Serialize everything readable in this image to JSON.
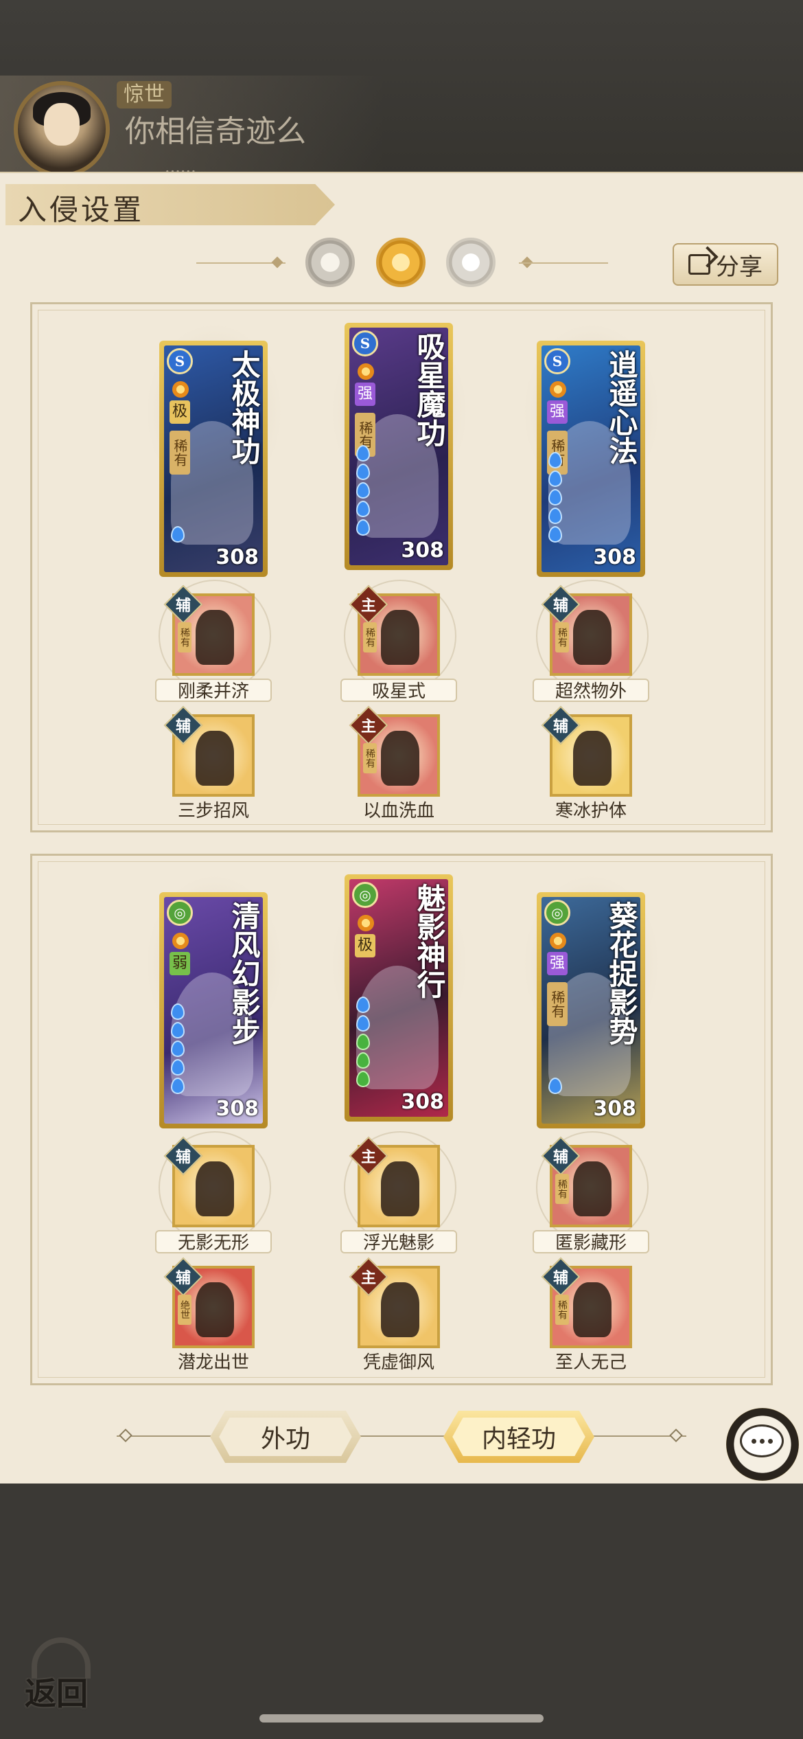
{
  "player": {
    "title_badge": "惊世",
    "name": "你相信奇迹么",
    "sub": "······"
  },
  "header": {
    "title": "入侵设置"
  },
  "share_button": {
    "label": "分享"
  },
  "sections": [
    {
      "cards": [
        {
          "name": "太极神功",
          "type_icon": "S",
          "grade": "极",
          "grade_color": "gold",
          "rarity": "稀有",
          "drops": [
            "blue"
          ],
          "level": "308"
        },
        {
          "name": "吸星魔功",
          "type_icon": "S",
          "grade": "强",
          "grade_color": "purple",
          "rarity": "稀有",
          "drops": [
            "blue",
            "blue",
            "blue",
            "blue",
            "blue"
          ],
          "level": "308"
        },
        {
          "name": "逍遥心法",
          "type_icon": "S",
          "grade": "强",
          "grade_color": "purple",
          "rarity": "稀有",
          "drops": [
            "blue",
            "blue",
            "blue",
            "blue",
            "blue"
          ],
          "level": "308"
        }
      ],
      "skills_row1": [
        {
          "role": "辅",
          "rare": "稀有",
          "label": "刚柔并济",
          "bg": "#e38b7a"
        },
        {
          "role": "主",
          "rare": "稀有",
          "label": "吸星式",
          "bg": "#d9776a"
        },
        {
          "role": "辅",
          "rare": "稀有",
          "label": "超然物外",
          "bg": "#d8786f"
        }
      ],
      "skills_row2": [
        {
          "role": "辅",
          "rare": "",
          "label": "三步招风",
          "bg": "#f0c468"
        },
        {
          "role": "主",
          "rare": "稀有",
          "label": "以血洗血",
          "bg": "#e07d6f"
        },
        {
          "role": "辅",
          "rare": "",
          "label": "寒冰护体",
          "bg": "#f2cf6d"
        }
      ]
    },
    {
      "cards": [
        {
          "name": "清风幻影步",
          "type_icon": "◎",
          "grade": "弱",
          "grade_color": "green",
          "rarity": "",
          "drops": [
            "blue",
            "blue",
            "blue",
            "blue",
            "blue"
          ],
          "level": "308"
        },
        {
          "name": "魅影神行",
          "type_icon": "◎",
          "grade": "极",
          "grade_color": "gold",
          "rarity": "",
          "drops": [
            "blue",
            "blue",
            "green",
            "green",
            "green"
          ],
          "level": "308"
        },
        {
          "name": "葵花捉影势",
          "type_icon": "◎",
          "grade": "强",
          "grade_color": "purple",
          "rarity": "稀有",
          "drops": [
            "blue"
          ],
          "level": "308"
        }
      ],
      "skills_row1": [
        {
          "role": "辅",
          "rare": "",
          "label": "无影无形",
          "bg": "#f0c468"
        },
        {
          "role": "主",
          "rare": "",
          "label": "浮光魅影",
          "bg": "#f0c468"
        },
        {
          "role": "辅",
          "rare": "稀有",
          "label": "匿影藏形",
          "bg": "#d9776a"
        }
      ],
      "skills_row2": [
        {
          "role": "辅",
          "rare": "绝世",
          "label": "潜龙出世",
          "bg": "#d9574a"
        },
        {
          "role": "主",
          "rare": "",
          "label": "凭虚御风",
          "bg": "#f0c468"
        },
        {
          "role": "辅",
          "rare": "稀有",
          "label": "至人无己",
          "bg": "#e2796a"
        }
      ]
    }
  ],
  "tabs": [
    {
      "label": "外功"
    },
    {
      "label": "内轻功"
    }
  ],
  "back_button": {
    "label": "返回"
  },
  "colors": {
    "panel": "#f1e9d9",
    "gold_frame": "#e9c65a",
    "card_blue": "#2b4a8a",
    "card_purple": "#4a2f6e"
  }
}
